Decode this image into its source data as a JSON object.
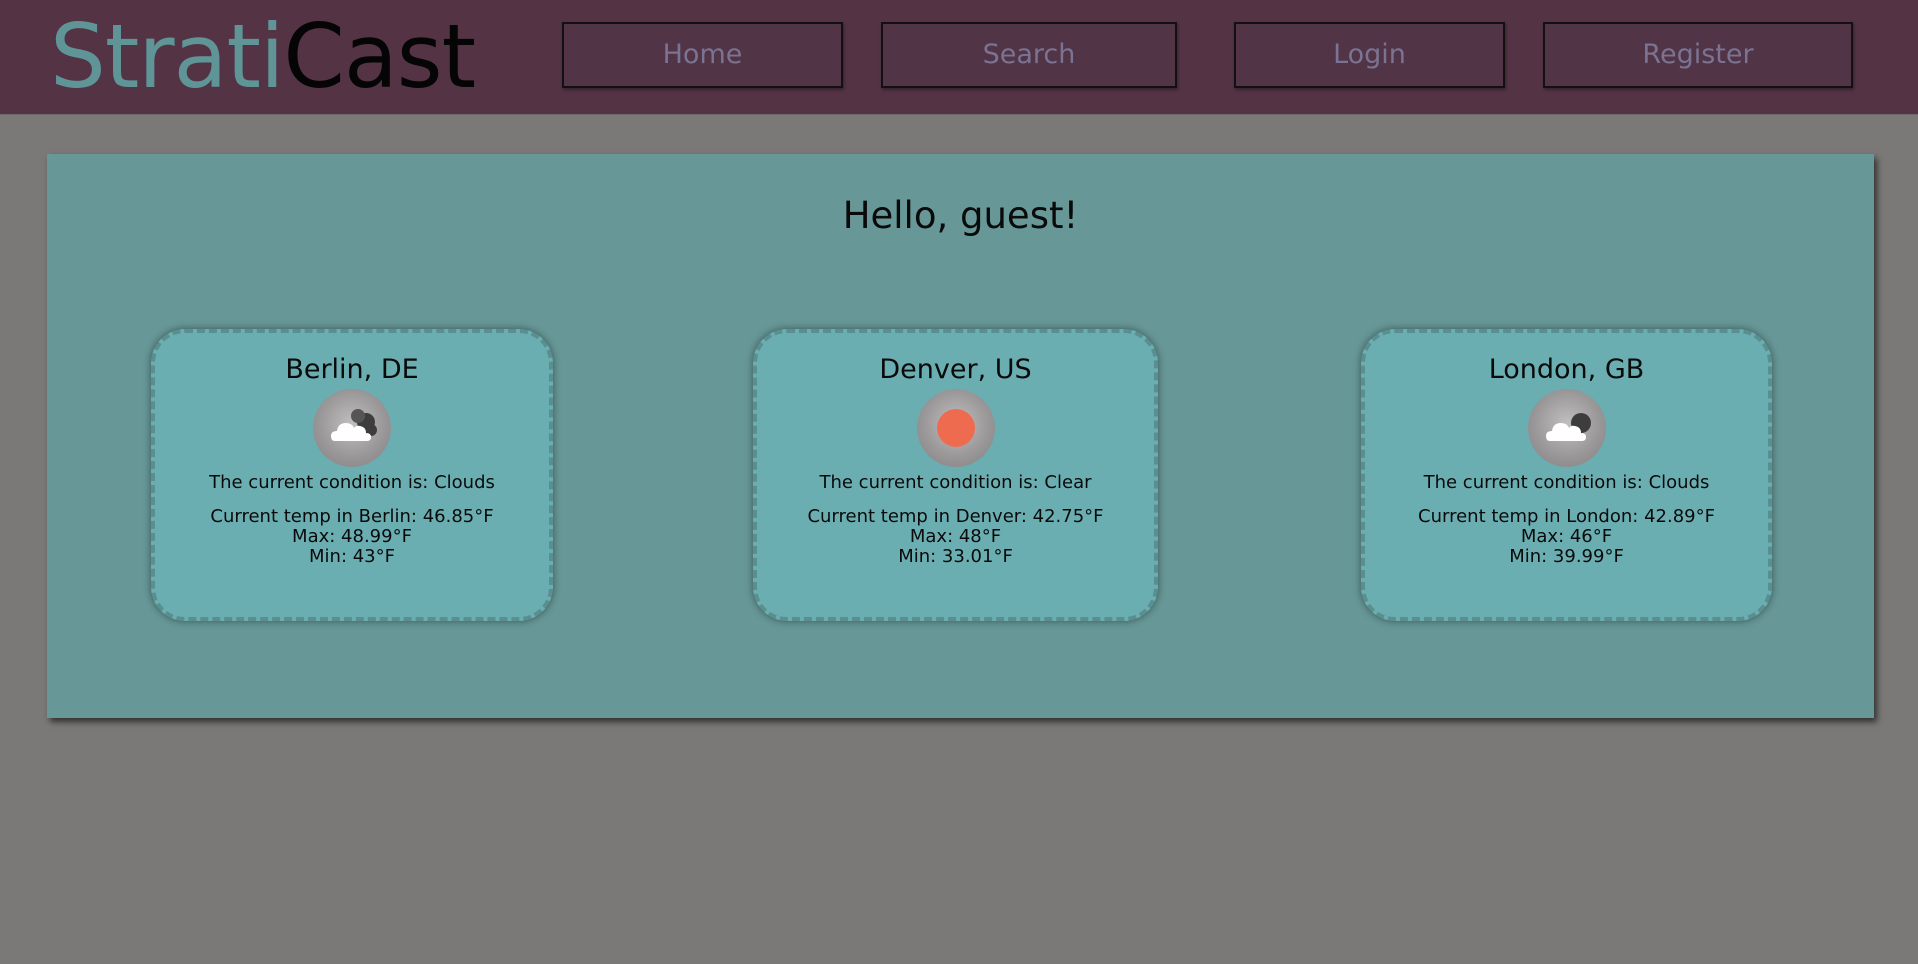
{
  "header": {
    "logo_part1": "Strati",
    "logo_part2": "Cast",
    "nav": {
      "home": "Home",
      "search": "Search",
      "login": "Login",
      "register": "Register"
    }
  },
  "main": {
    "greeting": "Hello, guest!",
    "cards": [
      {
        "city": "Berlin, DE",
        "icon": "clouds-icon",
        "condition": "The current condition is: Clouds",
        "current": "Current temp in Berlin: 46.85°F",
        "max": "Max: 48.99°F",
        "min": "Min: 43°F"
      },
      {
        "city": "Denver, US",
        "icon": "clear-sun-icon",
        "condition": "The current condition is: Clear",
        "current": "Current temp in Denver: 42.75°F",
        "max": "Max: 48°F",
        "min": "Min: 33.01°F"
      },
      {
        "city": "London, GB",
        "icon": "clouds-icon",
        "condition": "The current condition is: Clouds",
        "current": "Current temp in London: 42.89°F",
        "max": "Max: 46°F",
        "min": "Min: 39.99°F"
      }
    ]
  },
  "colors": {
    "header_bg": "#543345",
    "logo_accent": "#5f9597",
    "panel_bg": "#679797",
    "card_bg": "#6aaeb2",
    "page_bg": "#7a7978",
    "sun": "#ef6b4f"
  }
}
